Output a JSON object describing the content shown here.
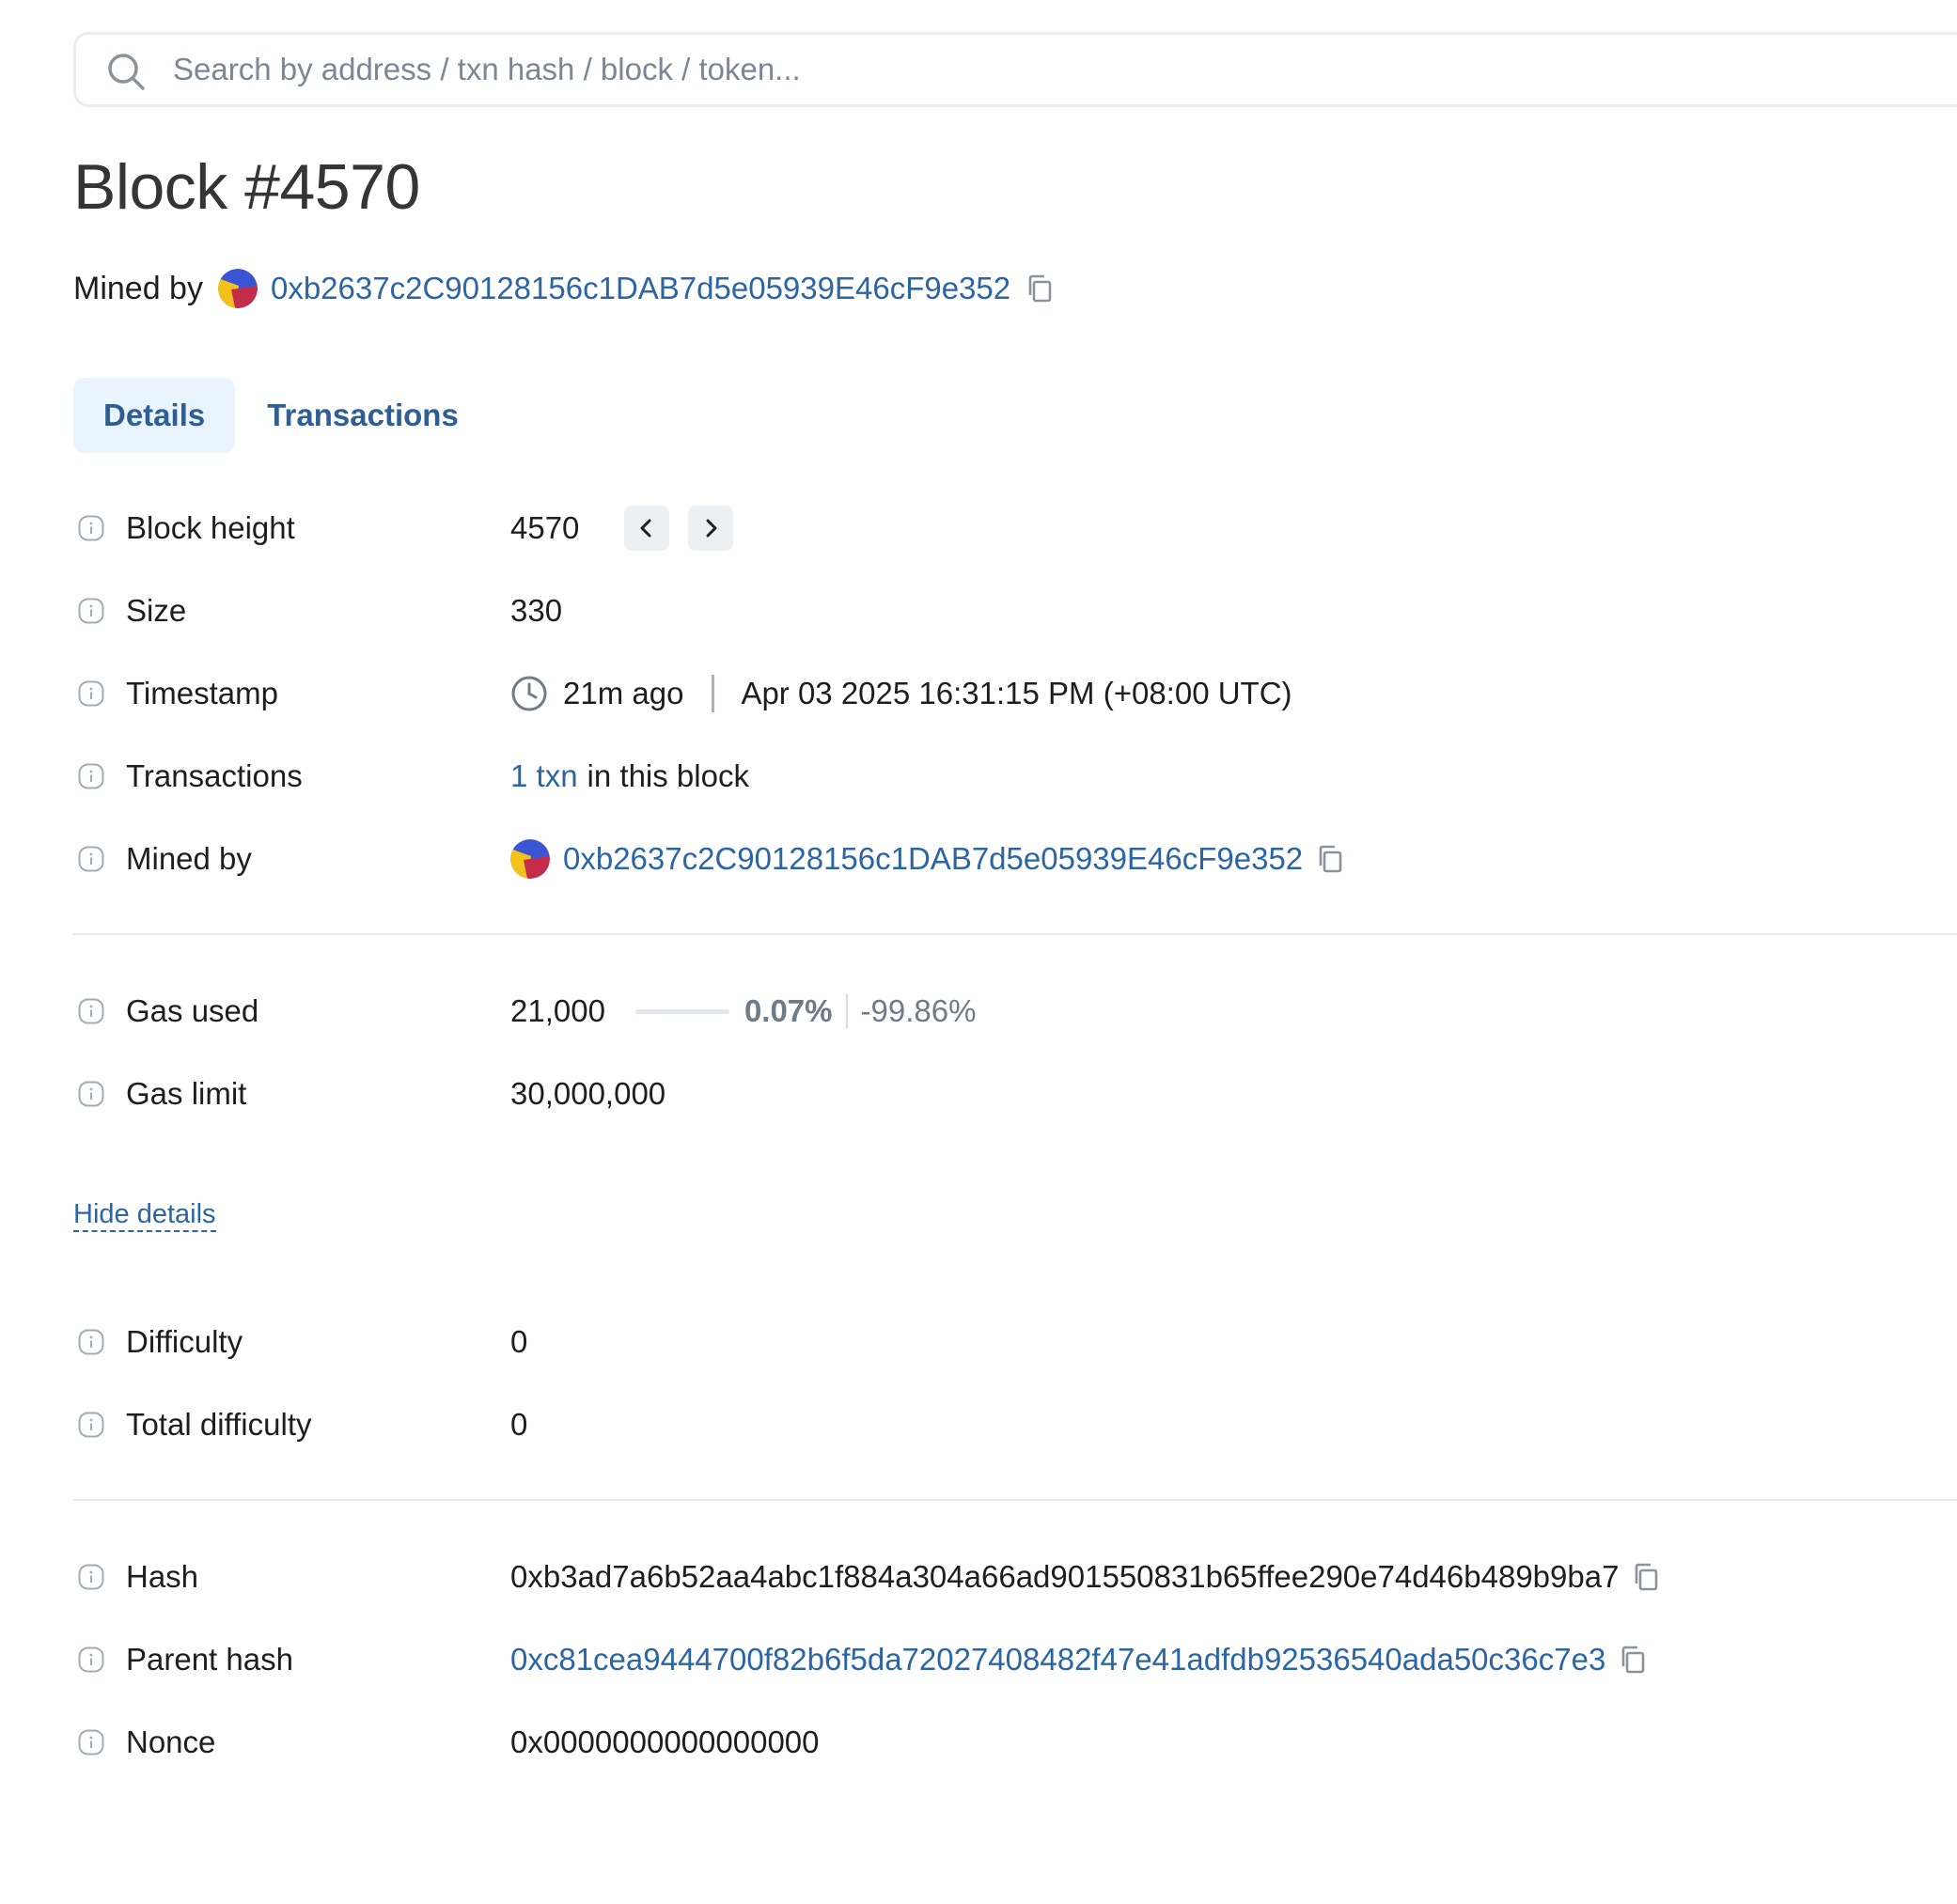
{
  "search": {
    "placeholder": "Search by address / txn hash / block / token..."
  },
  "page_title": "Block #4570",
  "header_miner": {
    "label": "Mined by",
    "address": "0xb2637c2C90128156c1DAB7d5e05939E46cF9e352"
  },
  "tabs": [
    {
      "label": "Details",
      "active": true
    },
    {
      "label": "Transactions",
      "active": false
    }
  ],
  "details": {
    "block_height": {
      "label": "Block height",
      "value": "4570"
    },
    "size": {
      "label": "Size",
      "value": "330"
    },
    "timestamp": {
      "label": "Timestamp",
      "relative": "21m ago",
      "absolute": "Apr 03 2025 16:31:15 PM (+08:00 UTC)"
    },
    "transactions": {
      "label": "Transactions",
      "link": "1 txn",
      "suffix": "in this block"
    },
    "mined_by": {
      "label": "Mined by",
      "address": "0xb2637c2C90128156c1DAB7d5e05939E46cF9e352"
    },
    "gas_used": {
      "label": "Gas used",
      "value": "21,000",
      "percent": "0.07%",
      "diff": "-99.86%",
      "fill_fraction": 0.0007
    },
    "gas_limit": {
      "label": "Gas limit",
      "value": "30,000,000"
    },
    "hide_details": "Hide details",
    "difficulty": {
      "label": "Difficulty",
      "value": "0"
    },
    "total_difficulty": {
      "label": "Total difficulty",
      "value": "0"
    },
    "hash": {
      "label": "Hash",
      "value": "0xb3ad7a6b52aa4abc1f884a304a66ad901550831b65ffee290e74d46b489b9ba7"
    },
    "parent_hash": {
      "label": "Parent hash",
      "value": "0xc81cea9444700f82b6f5da72027408482f47e41adfdb92536540ada50c36c7e3"
    },
    "nonce": {
      "label": "Nonce",
      "value": "0x0000000000000000"
    }
  },
  "colors": {
    "link": "#2c65a4",
    "tab_active_bg": "#eaf4fd",
    "muted": "#6f7b88"
  },
  "icons": [
    "search-icon",
    "copy-icon",
    "info-icon",
    "clock-icon",
    "chevron-left-icon",
    "chevron-right-icon",
    "miner-avatar"
  ]
}
